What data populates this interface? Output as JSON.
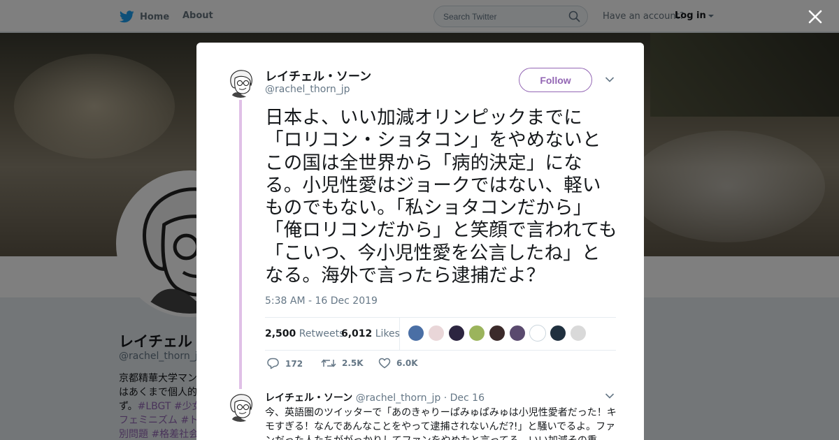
{
  "topbar": {
    "home_label": "Home",
    "about_label": "About",
    "search_placeholder": "Search Twitter",
    "have_account": "Have an account?",
    "login_label": "Log in"
  },
  "profile_bg": {
    "name": "レイチェル・",
    "handle": "@rachel_thorn_jp",
    "bio_line1": "京都精華大学マン",
    "bio_line2": "はあくまで個人的",
    "bio_line3_pre": "ず。",
    "bio_line3_tags": "#LBGT #少女",
    "bio_line4_tags": "フェミニズム #ト",
    "bio_line5_tags": "別問題 #格差社会"
  },
  "tweet": {
    "author_name": "レイチェル・ソーン",
    "author_handle": "@rachel_thorn_jp",
    "follow_label": "Follow",
    "text": "日本よ、いい加減オリンピックまでに「ロリコン・ショタコン」をやめないとこの国は全世界から「病的決定」になる。小児性愛はジョークではない、軽いものでもない。「私ショタコンだから」「俺ロリコンだから」と笑顔で言われても「こいつ、今小児性愛を公言したね」となる。海外で言ったら逮捕だよ？",
    "timestamp": "5:38 AM - 16 Dec 2019",
    "retweets_count": "2,500",
    "retweets_label": "Retweets",
    "likes_count": "6,012",
    "likes_label": "Likes",
    "reply_count": "172",
    "retweet_action_count": "2.5K",
    "like_action_count": "6.0K",
    "liker_colors": [
      "#4a6fa5",
      "#e9d6d8",
      "#2c2540",
      "#9bb45c",
      "#3b2a2a",
      "#5a4a6e",
      "#ffffff",
      "#20303f",
      "#d9d9d9"
    ]
  },
  "reply": {
    "author_name": "レイチェル・ソーン",
    "author_handle": "@rachel_thorn_jp",
    "date": "· Dec 16",
    "text": "今、英語圏のツイッターで「あのきゃりーぱみゅぱみゅは小児性愛者だった！キモすぎる！なんであんなことをやって逮捕されないんだ?!」と騒いでるよ。ファンだった人たちががっかりしてファンをやめたと言ってる。いい加減その重"
  },
  "colors": {
    "accent": "#9366b4",
    "thread_line": "#e0c0e7",
    "twitter_blue": "#1da1f2"
  }
}
